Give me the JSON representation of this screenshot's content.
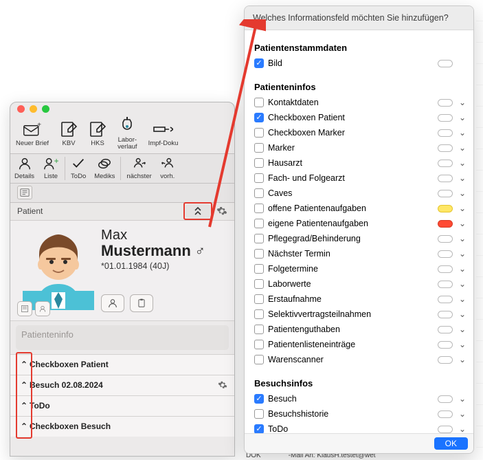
{
  "popover": {
    "title": "Welches Informationsfeld möchten Sie hinzufügen?",
    "ok": "OK",
    "groups": [
      {
        "title": "Patientenstammdaten",
        "items": [
          {
            "label": "Bild",
            "checked": true,
            "expand": false
          }
        ]
      },
      {
        "title": "Patienteninfos",
        "items": [
          {
            "label": "Kontaktdaten",
            "checked": false,
            "expand": true
          },
          {
            "label": "Checkboxen Patient",
            "checked": true,
            "expand": true
          },
          {
            "label": "Checkboxen Marker",
            "checked": false,
            "expand": true
          },
          {
            "label": "Marker",
            "checked": false,
            "expand": true
          },
          {
            "label": "Hausarzt",
            "checked": false,
            "expand": true
          },
          {
            "label": "Fach- und Folgearzt",
            "checked": false,
            "expand": true
          },
          {
            "label": "Caves",
            "checked": false,
            "expand": true
          },
          {
            "label": "offene Patientenaufgaben",
            "checked": false,
            "expand": true,
            "pill": "yellow"
          },
          {
            "label": "eigene Patientenaufgaben",
            "checked": false,
            "expand": true,
            "pill": "red"
          },
          {
            "label": "Pflegegrad/Behinderung",
            "checked": false,
            "expand": true
          },
          {
            "label": "Nächster Termin",
            "checked": false,
            "expand": true
          },
          {
            "label": "Folgetermine",
            "checked": false,
            "expand": true
          },
          {
            "label": "Laborwerte",
            "checked": false,
            "expand": true
          },
          {
            "label": "Erstaufnahme",
            "checked": false,
            "expand": true
          },
          {
            "label": "Selektivvertragsteilnahmen",
            "checked": false,
            "expand": true
          },
          {
            "label": "Patientenguthaben",
            "checked": false,
            "expand": true
          },
          {
            "label": "Patientenlisteneinträge",
            "checked": false,
            "expand": true
          },
          {
            "label": "Warenscanner",
            "checked": false,
            "expand": true
          }
        ]
      },
      {
        "title": "Besuchsinfos",
        "items": [
          {
            "label": "Besuch",
            "checked": true,
            "expand": true
          },
          {
            "label": "Besuchshistorie",
            "checked": false,
            "expand": true
          },
          {
            "label": "ToDo",
            "checked": true,
            "expand": true
          }
        ]
      }
    ]
  },
  "toolbar_top": [
    {
      "label": "Neuer Brief"
    },
    {
      "label": "KBV"
    },
    {
      "label": "HKS"
    },
    {
      "label": "Labor-\nverlauf"
    },
    {
      "label": "Impf-Doku"
    }
  ],
  "toolbar_sec": [
    {
      "label": "Details"
    },
    {
      "label": "Liste"
    },
    {
      "label": "ToDo"
    },
    {
      "label": "Mediks"
    },
    {
      "label": "nächster"
    },
    {
      "label": "vorh."
    }
  ],
  "section_title": "Patient",
  "patient": {
    "first": "Max",
    "last": "Mustermann",
    "meta": "*01.01.1984 (40J)",
    "gender_sym": "♂",
    "info_placeholder": "Patienteninfo"
  },
  "accordion": [
    {
      "title": "Checkboxen Patient"
    },
    {
      "title": "Besuch 02.08.2024",
      "gear": true
    },
    {
      "title": "ToDo"
    },
    {
      "title": "Checkboxen Besuch"
    }
  ],
  "footer": {
    "left": "DOK",
    "right": "-Mail An: KlausH.testet@wet"
  }
}
